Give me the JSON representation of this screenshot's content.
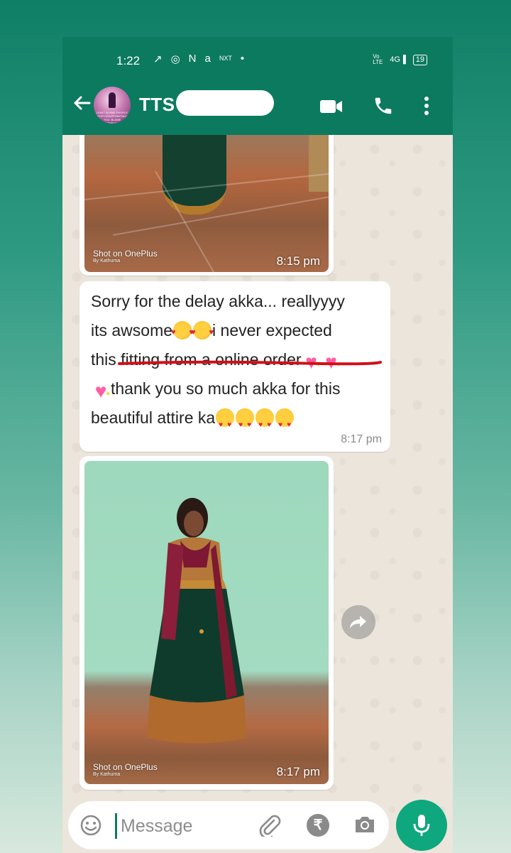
{
  "status_bar": {
    "time": "1:22",
    "icons": [
      "missed-call-icon",
      "instagram-icon",
      "nfc-icon",
      "amazon-icon",
      "nxt-icon",
      "dot-icon"
    ],
    "network": "4G",
    "volte": "Vo LTE",
    "battery": "19"
  },
  "header": {
    "contact_name": "TTS",
    "avatar_caption": "DON'T BLAME PEOPLE FOR DISAPPOINTING YOU. BLAME YOURSELF FOR EXPECTING TOO MUCH.",
    "icons": [
      "back-arrow-icon",
      "video-call-icon",
      "phone-icon",
      "more-vert-icon"
    ]
  },
  "messages": [
    {
      "type": "image",
      "watermark": "Shot on OnePlus",
      "watermark_sub": "By Kathuma",
      "time": "8:15 pm"
    },
    {
      "type": "text",
      "lines": [
        "Sorry for the delay akka... reallyyyy",
        "its awsome",
        "i never expected",
        "this fitting from a online order",
        "thank you so much akka for this",
        "beautiful attire ka"
      ],
      "emojis": [
        "smiling-face-with-hearts",
        "heart-eyes",
        "sparkling-heart"
      ],
      "time": "8:17 pm"
    },
    {
      "type": "image",
      "watermark": "Shot on OnePlus",
      "watermark_sub": "By Kathuma",
      "time": "8:17 pm"
    }
  ],
  "composer": {
    "placeholder": "Message",
    "icons": [
      "emoji-icon",
      "attach-icon",
      "rupee-payment-icon",
      "camera-icon",
      "mic-icon"
    ],
    "rupee_symbol": "₹"
  },
  "colors": {
    "header_green": "#0c7a5f",
    "mic_green": "#0fa77d",
    "chat_bg": "#ebe5dc",
    "underline_red": "#d0101a"
  }
}
